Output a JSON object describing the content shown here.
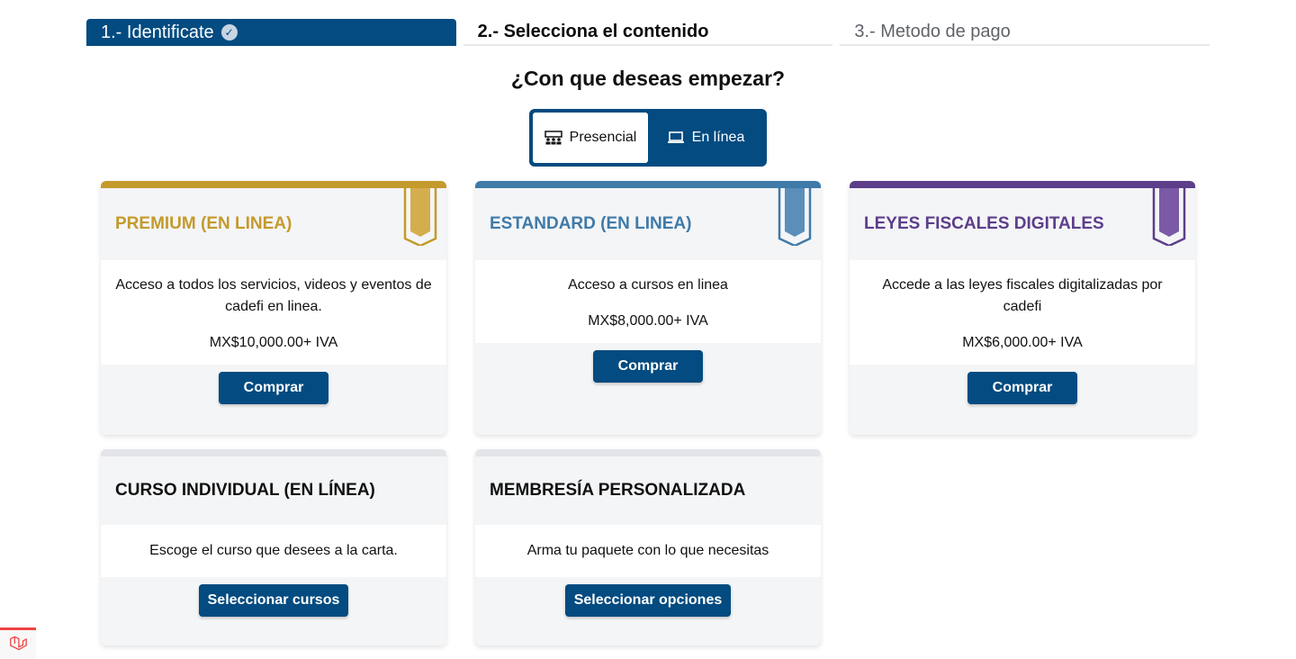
{
  "steps": [
    {
      "label": "1.- Identificate"
    },
    {
      "label": "2.- Selecciona el contenido"
    },
    {
      "label": "3.- Metodo de pago"
    }
  ],
  "heading": "¿Con que deseas empezar?",
  "toggle": {
    "presencial": "Presencial",
    "en_linea": "En línea"
  },
  "cards": [
    {
      "title": "PREMIUM (EN LINEA)",
      "description": "Acceso a todos los servicios, videos y eventos de cadefi en linea.",
      "price": "MX$10,000.00+ IVA",
      "button": "Comprar",
      "color": "#c49a2c",
      "ribbon_fill": "#d4ad4e"
    },
    {
      "title": "ESTANDARD (EN LINEA)",
      "description": "Acceso a cursos en linea",
      "price": "MX$8,000.00+ IVA",
      "button": "Comprar",
      "color": "#3f7aa8",
      "ribbon_fill": "#5b8fba"
    },
    {
      "title": "LEYES FISCALES DIGITALES",
      "description": "Accede a las leyes fiscales digitalizadas por cadefi",
      "price": "MX$6,000.00+ IVA",
      "button": "Comprar",
      "color": "#5c3e8a",
      "ribbon_fill": "#7a5aa6"
    },
    {
      "title": "CURSO INDIVIDUAL (EN LÍNEA)",
      "description": "Escoge el curso que desees a la carta.",
      "button": "Seleccionar cursos",
      "color": "#111111"
    },
    {
      "title": "MEMBRESÍA PERSONALIZADA",
      "description": "Arma tu paquete con lo que necesitas",
      "button": "Seleccionar opciones",
      "color": "#111111"
    }
  ],
  "icons": {
    "check": "check-circle-icon",
    "presencial": "people-icon",
    "en_linea": "laptop-icon",
    "ribbon": "ribbon-icon",
    "laravel": "laravel-logo-icon"
  },
  "colors": {
    "primary": "#034b80",
    "card_bg": "#f4f5f7"
  }
}
